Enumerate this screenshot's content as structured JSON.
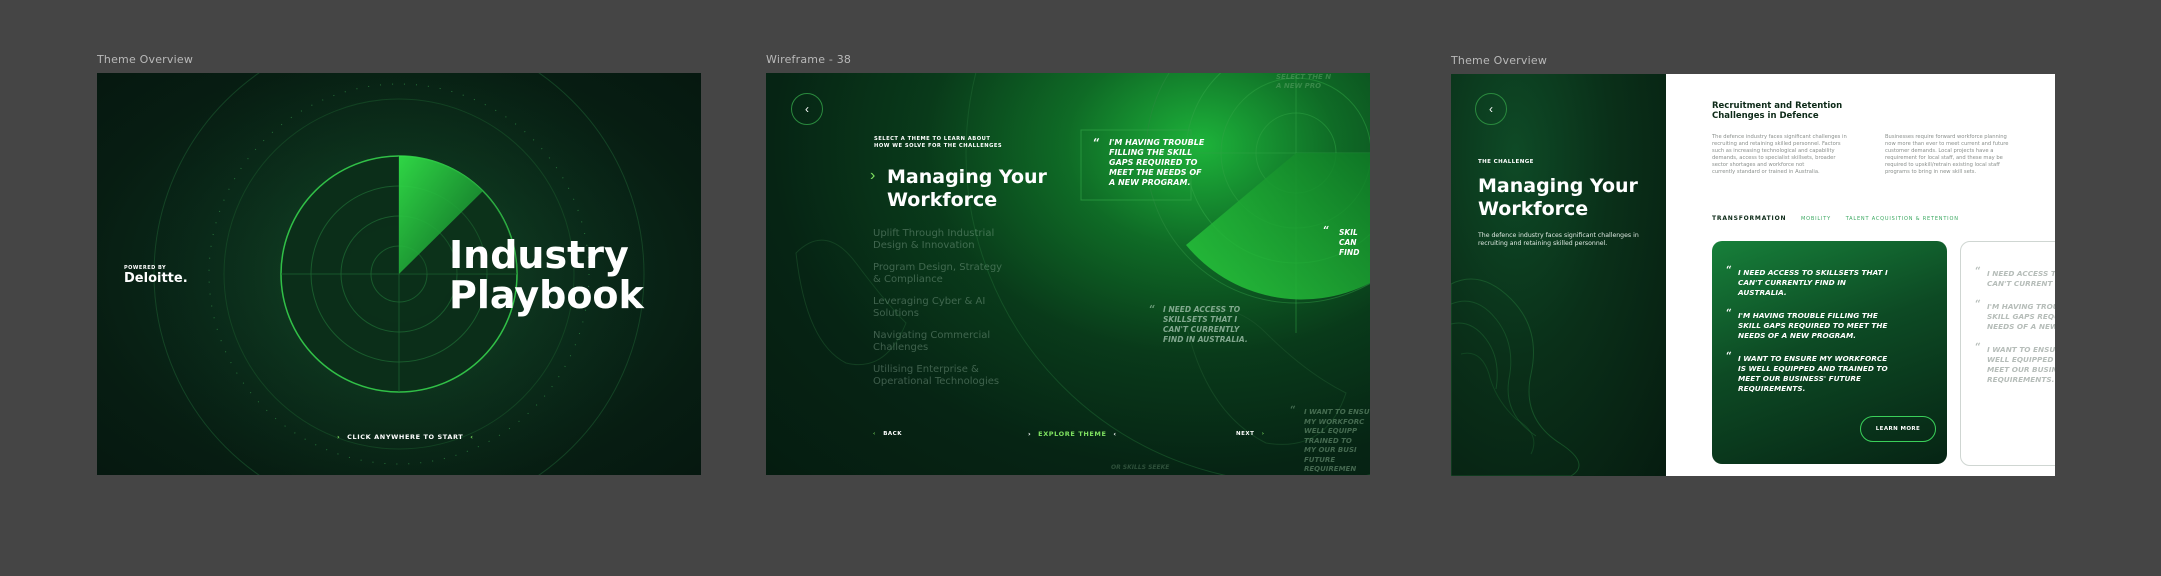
{
  "frames": [
    {
      "label": "Theme Overview",
      "powered_by": "POWERED BY",
      "brand": "Deloitte.",
      "title_line1": "Industry",
      "title_line2": "Playbook",
      "cta": "CLICK ANYWHERE TO START"
    },
    {
      "label": "Wireframe - 38",
      "eyebrow_line1": "SELECT A THEME TO LEARN ABOUT",
      "eyebrow_line2": "HOW WE SOLVE FOR THE CHALLENGES",
      "title_line1": "Managing Your",
      "title_line2": "Workforce",
      "themes": [
        {
          "line1": "Uplift Through Industrial",
          "line2": "Design & Innovation"
        },
        {
          "line1": "Program Design, Strategy",
          "line2": "& Compliance"
        },
        {
          "line1": "Leveraging Cyber & AI",
          "line2": "Solutions"
        },
        {
          "line1": "Navigating Commercial",
          "line2": "Challenges"
        },
        {
          "line1": "Utilising Enterprise &",
          "line2": "Operational Technologies"
        }
      ],
      "quote_main": [
        "I'M HAVING TROUBLE",
        "FILLING THE SKILL",
        "GAPS REQUIRED TO",
        "MEET THE NEEDS OF",
        "A NEW PROGRAM."
      ],
      "quote_second": [
        "I NEED ACCESS TO",
        "SKILLSETS THAT I",
        "CAN'T CURRENTLY",
        "FIND IN AUSTRALIA."
      ],
      "quote_right_partial": [
        "SKIL",
        "CAN",
        "FIND"
      ],
      "quote_top_partial": [
        "SELECT THE N",
        "A NEW PRO"
      ],
      "quote_bottom_right": [
        "I WANT TO ENSU",
        "MY WORKFORC",
        "WELL EQUIPP",
        "TRAINED TO",
        "MY OUR BUSI",
        "FUTURE",
        "REQUIREMEN"
      ],
      "back": "BACK",
      "explore": "EXPLORE THEME",
      "next": "NEXT",
      "bottom_faded": "OR SKILLS SEEKE"
    },
    {
      "label": "Theme Overview",
      "eyebrow": "THE CHALLENGE",
      "title_line1": "Managing Your",
      "title_line2": "Workforce",
      "subtitle_line1": "The defence industry faces significant challenges in",
      "subtitle_line2": "recruiting and retaining skilled personnel.",
      "heading_line1": "Recruitment and Retention",
      "heading_line2": "Challenges in Defence",
      "para1": [
        "The defence industry faces significant challenges in",
        "recruiting and retaining skilled personnel. Factors",
        "such as increasing technological and capability",
        "demands, access to specialist skillsets, broader",
        "sector shortages and workforce not",
        "currently standard or trained in Australia."
      ],
      "para2": [
        "Businesses require forward workforce planning",
        "now more than ever to meet current and future",
        "customer demands. Local projects have a",
        "requirement for local staff, and these may be",
        "required to upskill/retrain existing local staff",
        "programs to bring in new skill sets."
      ],
      "tabs": [
        "TRANSFORMATION",
        "MOBILITY",
        "TALENT ACQUISITION & RETENTION"
      ],
      "card_quotes": [
        [
          "I NEED ACCESS TO SKILLSETS THAT I",
          "CAN'T CURRENTLY FIND IN",
          "AUSTRALIA."
        ],
        [
          "I'M HAVING TROUBLE FILLING THE",
          "SKILL GAPS REQUIRED TO MEET THE",
          "NEEDS OF A NEW PROGRAM."
        ],
        [
          "I WANT TO ENSURE MY WORKFORCE",
          "IS WELL EQUIPPED AND TRAINED TO",
          "MEET OUR BUSINESS' FUTURE",
          "REQUIREMENTS."
        ]
      ],
      "learn_more": "LEARN MORE",
      "card2_quotes": [
        [
          "I NEED ACCESS TO",
          "CAN'T CURRENT"
        ],
        [
          "I'M HAVING TROU",
          "SKILL GAPS REQU",
          "NEEDS OF A NEW"
        ],
        [
          "I WANT TO ENSU",
          "WELL EQUIPPED",
          "MEET OUR BUSIN",
          "REQUIREMENTS."
        ]
      ]
    }
  ],
  "colors": {
    "canvas": "#454545",
    "accent_green": "#7ee060",
    "radar_green": "#2bd13f",
    "dark_green": "#061810",
    "card_green": "#0d4a24"
  }
}
